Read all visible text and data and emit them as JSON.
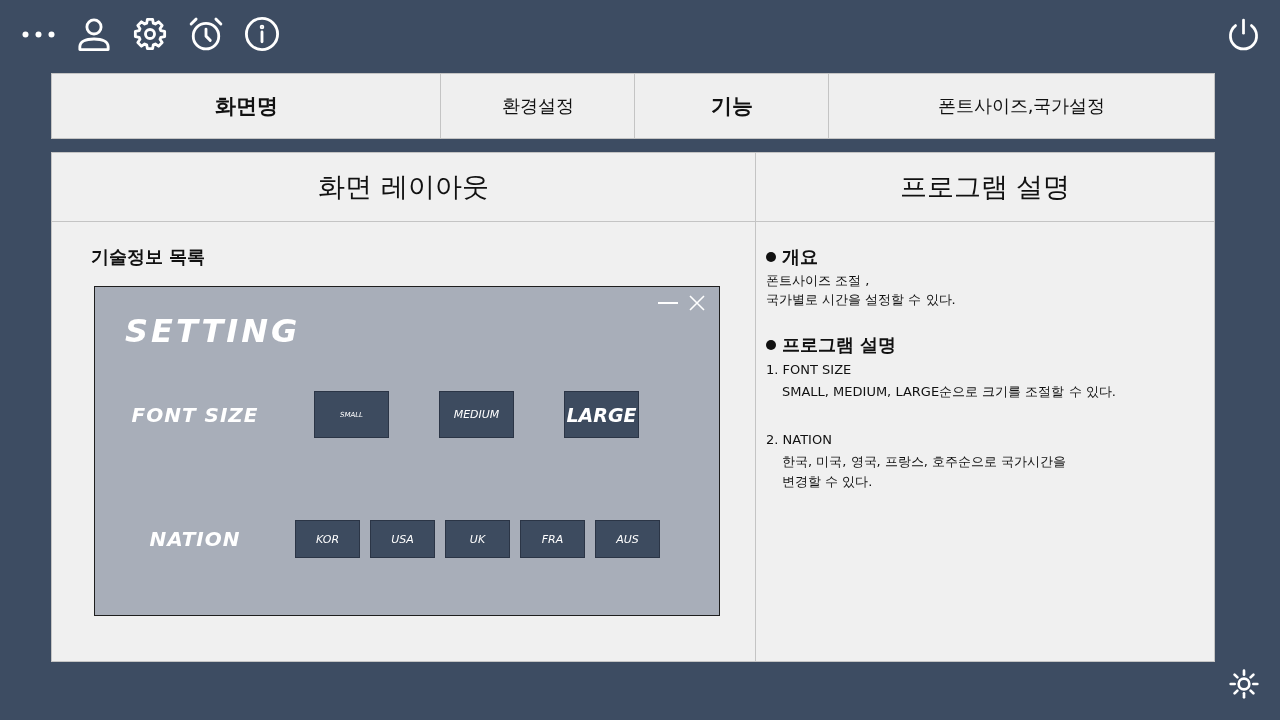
{
  "header_table": {
    "cells": [
      {
        "kind": "label",
        "text": "화면명"
      },
      {
        "kind": "value",
        "text": "환경설정"
      },
      {
        "kind": "label",
        "text": "기능"
      },
      {
        "kind": "value",
        "text": "폰트사이즈,국가설정"
      }
    ]
  },
  "layout_panel": {
    "title": "화면 레이아웃",
    "caption": "기술정보 목록",
    "settings_window": {
      "title": "SETTING",
      "font_size": {
        "label": "FONT SIZE",
        "buttons": [
          {
            "text": "SMALL",
            "kind": "small"
          },
          {
            "text": "MEDIUM",
            "kind": "medium"
          },
          {
            "text": "LARGE",
            "kind": "large"
          }
        ]
      },
      "nation": {
        "label": "NATION",
        "buttons": [
          "KOR",
          "USA",
          "UK",
          "FRA",
          "AUS"
        ]
      }
    }
  },
  "description_panel": {
    "title": "프로그램 설명",
    "sections": [
      {
        "heading": "개요",
        "lines": [
          "폰트사이즈 조절 ,",
          "국가별로 시간을 설정할 수 있다."
        ]
      },
      {
        "heading": "프로그램 설명",
        "items": [
          {
            "title": "1. FONT SIZE",
            "lines": [
              "SMALL, MEDIUM, LARGE순으로 크기를 조절할 수 있다."
            ]
          },
          {
            "title": "2. NATION",
            "lines": [
              "한국, 미국, 영국, 프랑스, 호주순으로 국가시간을",
              "변경할 수 있다."
            ]
          }
        ]
      }
    ]
  }
}
